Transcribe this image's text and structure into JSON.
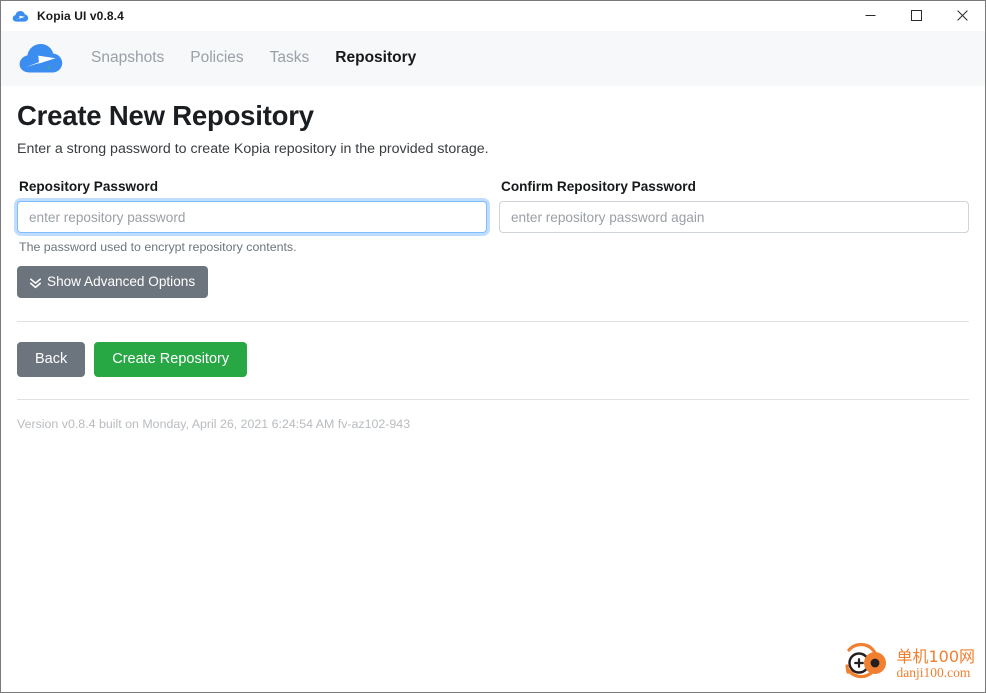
{
  "titlebar": {
    "title": "Kopia UI v0.8.4",
    "logo_icon": "kopia-cloud-logo-icon",
    "controls": [
      {
        "name": "minimize-button",
        "icon": "minimize-icon"
      },
      {
        "name": "maximize-button",
        "icon": "maximize-icon"
      },
      {
        "name": "close-button",
        "icon": "close-icon"
      }
    ]
  },
  "navbar": {
    "brand_icon": "kopia-cloud-brand-icon",
    "links": [
      {
        "label": "Snapshots",
        "active": false
      },
      {
        "label": "Policies",
        "active": false
      },
      {
        "label": "Tasks",
        "active": false
      },
      {
        "label": "Repository",
        "active": true
      }
    ]
  },
  "page": {
    "title": "Create New Repository",
    "subtitle": "Enter a strong password to create Kopia repository in the provided storage."
  },
  "form": {
    "password": {
      "label": "Repository Password",
      "value": "",
      "placeholder": "enter repository password",
      "help": "The password used to encrypt repository contents.",
      "focused": true
    },
    "confirm": {
      "label": "Confirm Repository Password",
      "value": "",
      "placeholder": "enter repository password again",
      "focused": false
    },
    "advanced_button": {
      "label": "Show Advanced Options",
      "icon": "chevron-double-down-icon"
    }
  },
  "actions": {
    "back_label": "Back",
    "create_label": "Create Repository"
  },
  "footer": {
    "version": "Version v0.8.4 built on Monday, April 26, 2021 6:24:54 AM fv-az102-943"
  },
  "watermark": {
    "cn": "单机100网",
    "url": "danji100.com",
    "logo_icon": "danji100-logo-icon"
  },
  "colors": {
    "brand_blue": "#3b8ef0",
    "nav_bg": "#f6f8fa",
    "success_green": "#28a745",
    "secondary_gray": "#6c757d",
    "focus_blue": "#80bdff",
    "watermark_orange": "#f08030"
  }
}
